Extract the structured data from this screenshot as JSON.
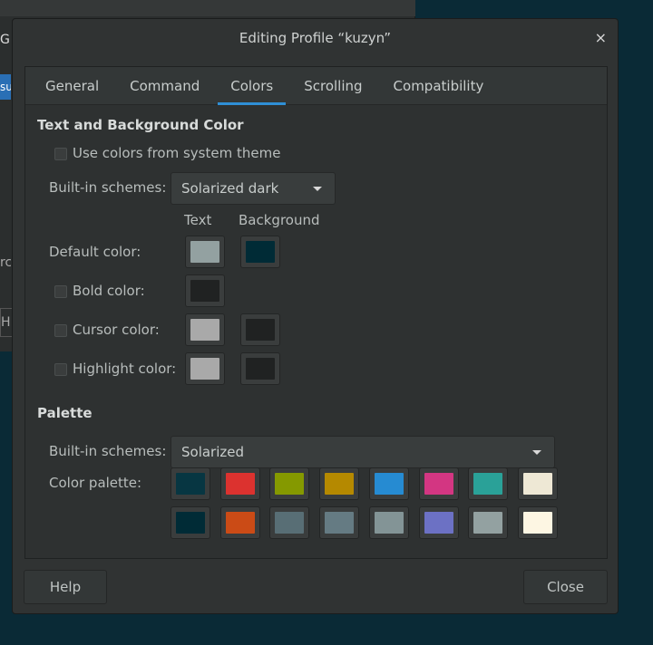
{
  "background_window": {
    "g": "G",
    "su": "su",
    "rc": "rc",
    "h": "H"
  },
  "dialog": {
    "title": "Editing Profile “kuzyn”",
    "close_glyph": "×"
  },
  "tabs": [
    {
      "label": "General"
    },
    {
      "label": "Command"
    },
    {
      "label": "Colors"
    },
    {
      "label": "Scrolling"
    },
    {
      "label": "Compatibility"
    }
  ],
  "active_tab": "Colors",
  "text_bg": {
    "title": "Text and Background Color",
    "use_system": "Use colors from system theme",
    "builtin_label": "Built-in schemes:",
    "builtin_value": "Solarized dark",
    "col_text": "Text",
    "col_background": "Background",
    "default_label": "Default color:",
    "bold_label": "Bold color:",
    "cursor_label": "Cursor color:",
    "highlight_label": "Highlight color:",
    "colors": {
      "default_text": "#93a1a1",
      "default_bg": "#002b36",
      "bold": "#202222",
      "cursor_text": "#a9a9a9",
      "cursor_bg": "#202222",
      "highlight_text": "#a9a9a9",
      "highlight_bg": "#202222"
    }
  },
  "palette": {
    "title": "Palette",
    "builtin_label": "Built-in schemes:",
    "builtin_value": "Solarized",
    "palette_label": "Color palette:",
    "row1": [
      "#073642",
      "#dc322f",
      "#859900",
      "#b58900",
      "#268bd2",
      "#d33682",
      "#2aa198",
      "#eee8d5"
    ],
    "row2": [
      "#002b36",
      "#cb4b16",
      "#586e75",
      "#657b83",
      "#839496",
      "#6c71c4",
      "#93a1a1",
      "#fdf6e3"
    ]
  },
  "buttons": {
    "help": "Help",
    "close": "Close"
  }
}
